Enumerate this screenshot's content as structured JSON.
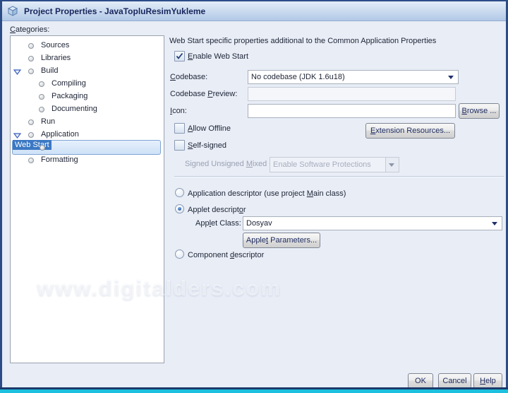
{
  "window": {
    "title": "Project Properties - JavaTopluResimYukleme"
  },
  "categories": {
    "label": {
      "m": "C",
      "post": "ategories:"
    },
    "items": [
      {
        "label": "Sources"
      },
      {
        "label": "Libraries"
      },
      {
        "label": "Build",
        "expanded": true
      },
      {
        "label": "Compiling"
      },
      {
        "label": "Packaging"
      },
      {
        "label": "Documenting"
      },
      {
        "label": "Run"
      },
      {
        "label": "Application",
        "expanded": true
      },
      {
        "label": "Web Start",
        "selected": true
      },
      {
        "label": "Formatting"
      }
    ]
  },
  "content": {
    "description": "Web Start specific properties additional to the Common Application Properties",
    "enable_web_start": {
      "m": "E",
      "post": "nable Web Start",
      "checked": true
    },
    "codebase": {
      "label": {
        "m": "C",
        "post": "odebase:"
      },
      "value": "No codebase (JDK 1.6u18)"
    },
    "codebase_preview": {
      "label": {
        "pre": "Codebase ",
        "m": "P",
        "post": "review:"
      },
      "value": ""
    },
    "icon_field": {
      "label": {
        "m": "I",
        "post": "con:"
      },
      "value": ""
    },
    "browse_button": {
      "m": "B",
      "post": "rowse ..."
    },
    "allow_offline": {
      "m": "A",
      "post": "llow Offline",
      "checked": false
    },
    "extension_resources_button": {
      "m": "E",
      "post": "xtension Resources..."
    },
    "self_signed": {
      "m": "S",
      "post": "elf-signed",
      "checked": false
    },
    "mixed_code": {
      "label": {
        "pre": "Signed Unsigned ",
        "m": "M",
        "post": "ixed Code:"
      },
      "value": "Enable Software Protections",
      "disabled": true
    },
    "application_descriptor": {
      "pre": "Application descriptor (use project ",
      "m": "M",
      "post": "ain class)",
      "selected": false
    },
    "applet_descriptor": {
      "pre": "Applet descript",
      "m": "o",
      "post": "r",
      "selected": true
    },
    "applet_class": {
      "label": {
        "pre": "App",
        "m": "l",
        "post": "et Class:"
      },
      "value": "Dosyav"
    },
    "applet_parameters_button": {
      "pre": "Apple",
      "m": "t",
      "post": " Parameters..."
    },
    "component_descriptor": {
      "pre": "Component ",
      "m": "d",
      "post": "escriptor",
      "selected": false
    }
  },
  "watermark": "www.digitalders.com",
  "footer": {
    "ok": "OK",
    "cancel": "Cancel",
    "help": {
      "m": "H",
      "post": "elp"
    }
  },
  "colors": {
    "selection_blue": "#3b78c3",
    "selection_border": "#7fa5d4",
    "dialog_bg": "#e8edf6",
    "window_border": "#2c4c88",
    "bottom_cyan": "#1cc0de",
    "titlebar_top": "#e2ecf8",
    "titlebar_bottom": "#b2c8e6",
    "close_red": "#c0391b",
    "disabled_text": "#9ba1b2"
  }
}
